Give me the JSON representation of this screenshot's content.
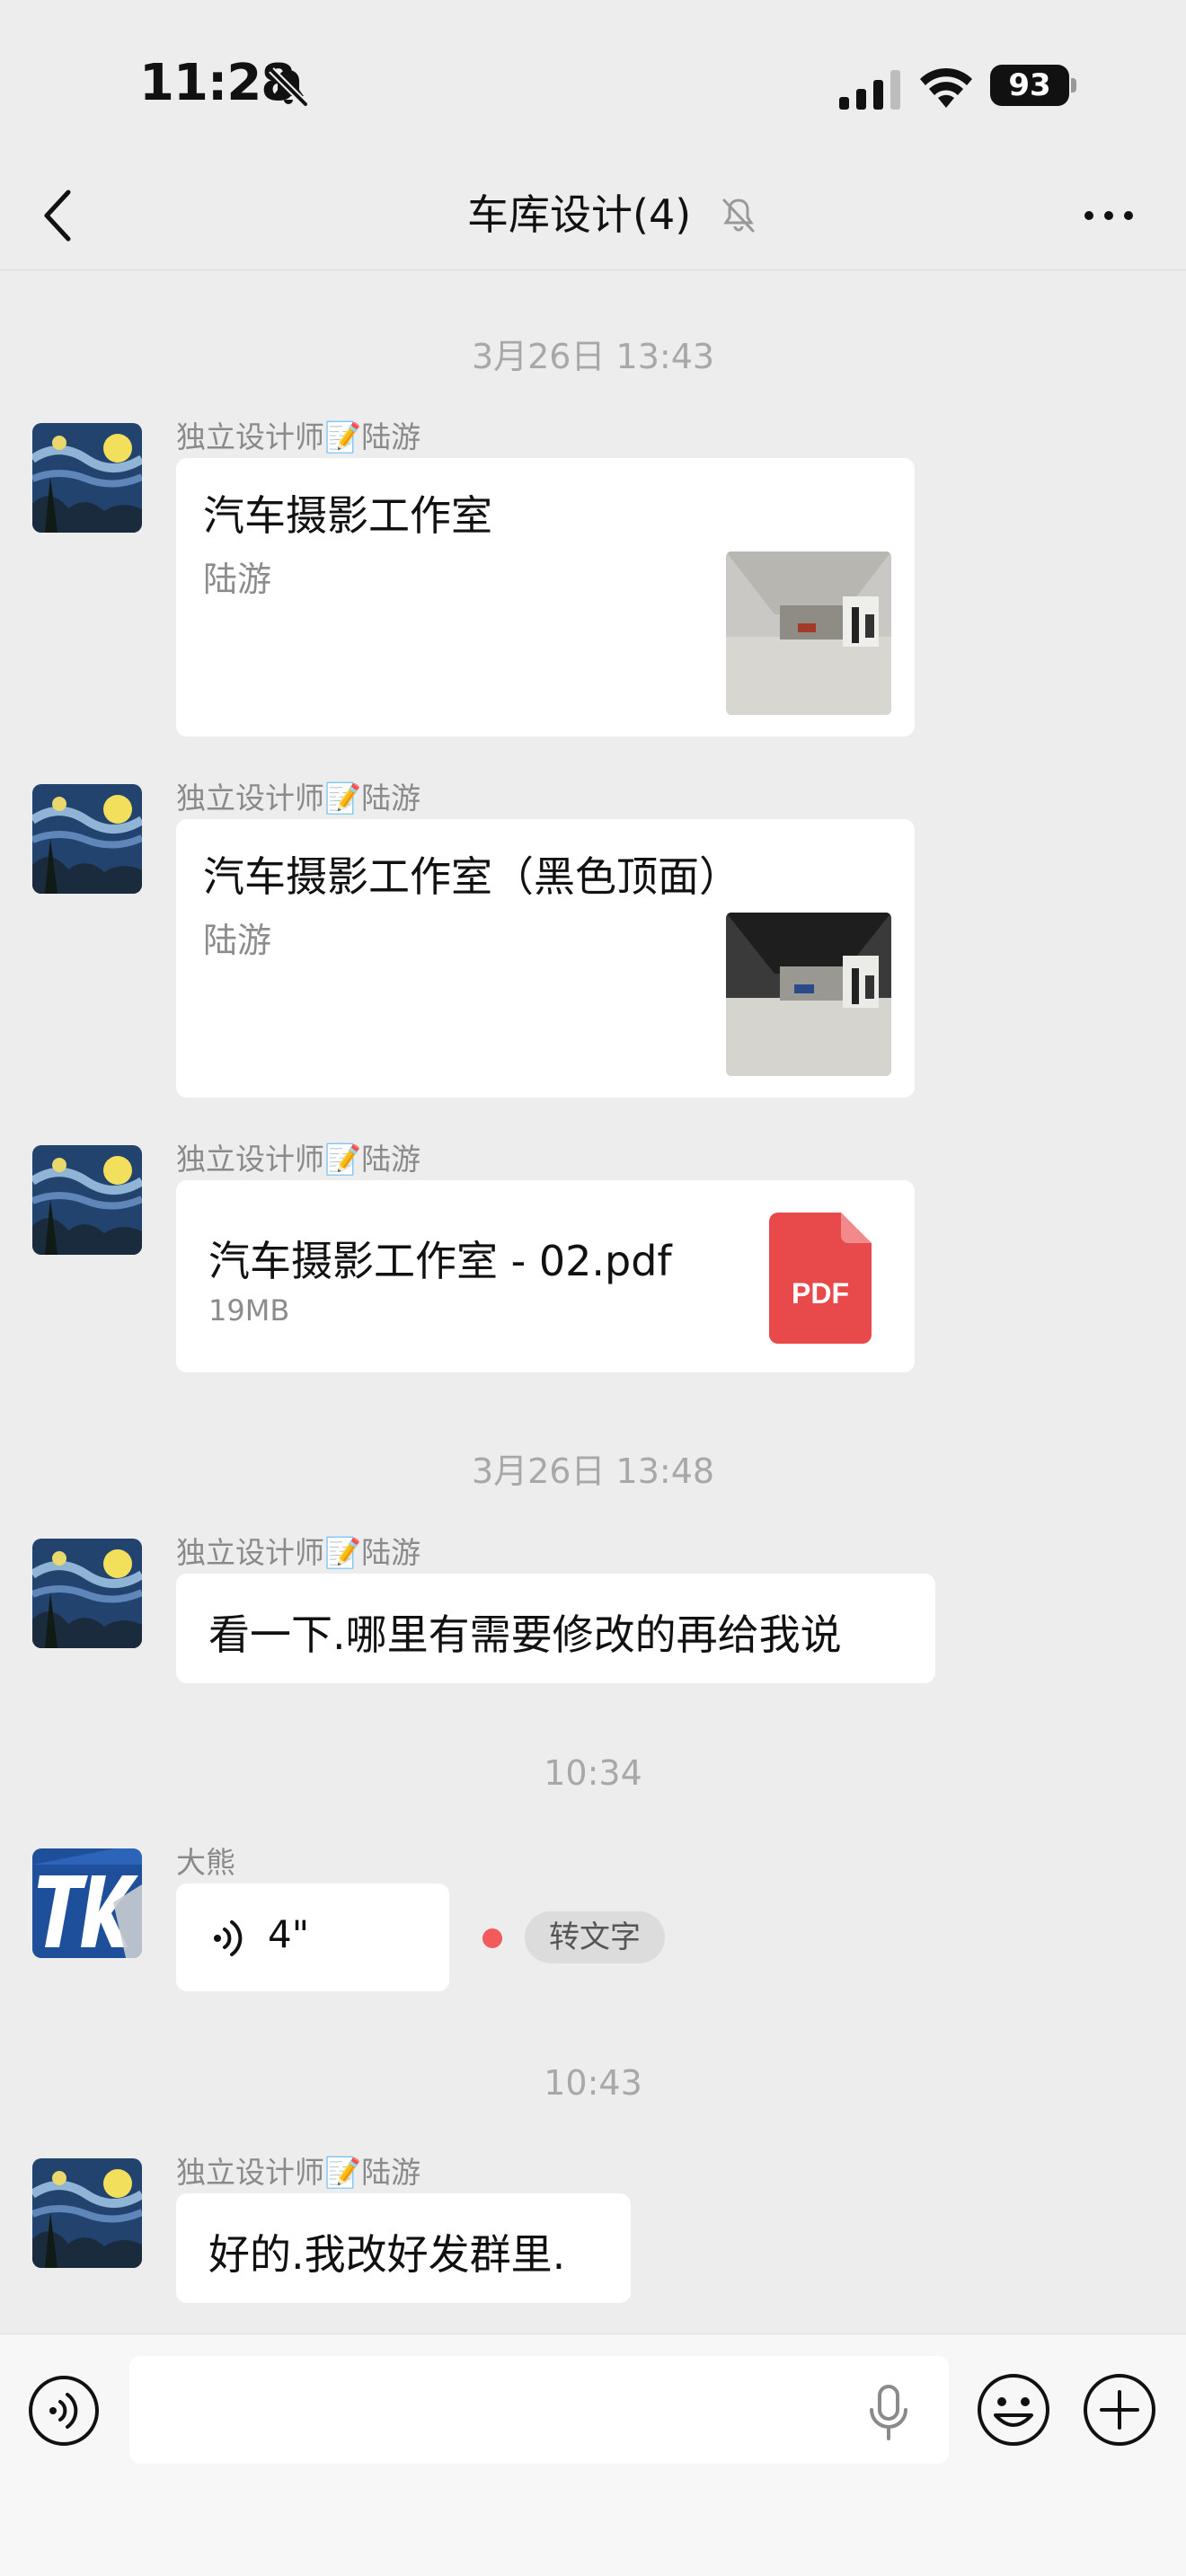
{
  "status_bar": {
    "time": "11:28",
    "battery": "93"
  },
  "header": {
    "title": "车库设计(4)"
  },
  "timestamps": [
    "3月26日 13:43",
    "3月26日 13:48",
    "10:34",
    "10:43"
  ],
  "messages": [
    {
      "sender": "独立设计师📝陆游",
      "type": "link",
      "title": "汽车摄影工作室",
      "subtitle": "陆游"
    },
    {
      "sender": "独立设计师📝陆游",
      "type": "link",
      "title": "汽车摄影工作室（黑色顶面）",
      "subtitle": "陆游"
    },
    {
      "sender": "独立设计师📝陆游",
      "type": "file",
      "filename": "汽车摄影工作室 - 02.pdf",
      "size": "19MB",
      "badge": "PDF"
    },
    {
      "sender": "独立设计师📝陆游",
      "type": "text",
      "text": "看一下.哪里有需要修改的再给我说"
    },
    {
      "sender": "大熊",
      "type": "voice",
      "duration": "4\"",
      "action": "转文字"
    },
    {
      "sender": "独立设计师📝陆游",
      "type": "text",
      "text": "好的.我改好发群里."
    }
  ],
  "input": {
    "placeholder": ""
  },
  "colors": {
    "background": "#ededed",
    "bubble": "#ffffff",
    "pdf_red": "#e8494b",
    "unread_dot": "#f25b5b"
  },
  "icons": [
    "bell-off-icon",
    "signal-icon",
    "wifi-icon",
    "back-icon",
    "mute-icon",
    "more-icon",
    "voice-icon",
    "mic-icon",
    "emoji-icon",
    "plus-icon"
  ]
}
